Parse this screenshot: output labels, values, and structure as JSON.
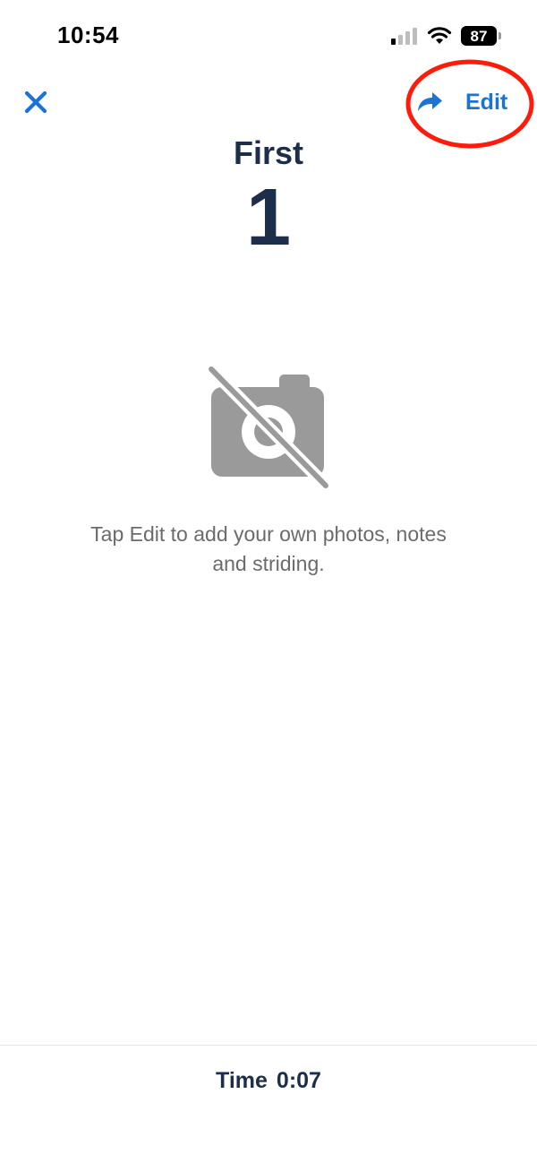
{
  "status_bar": {
    "time": "10:54",
    "battery_level": "87",
    "signal_icon": "cellular-signal-icon",
    "wifi_icon": "wifi-icon"
  },
  "nav": {
    "close_icon": "close-icon",
    "share_icon": "share-icon",
    "edit_label": "Edit",
    "accent_color": "#1a73d6",
    "highlight_color": "#ff1a0a"
  },
  "header": {
    "title": "First",
    "number": "1"
  },
  "empty_state": {
    "icon": "no-camera-icon",
    "message": "Tap Edit to add your own photos, notes and striding."
  },
  "footer": {
    "time_label": "Time",
    "time_value": "0:07"
  }
}
